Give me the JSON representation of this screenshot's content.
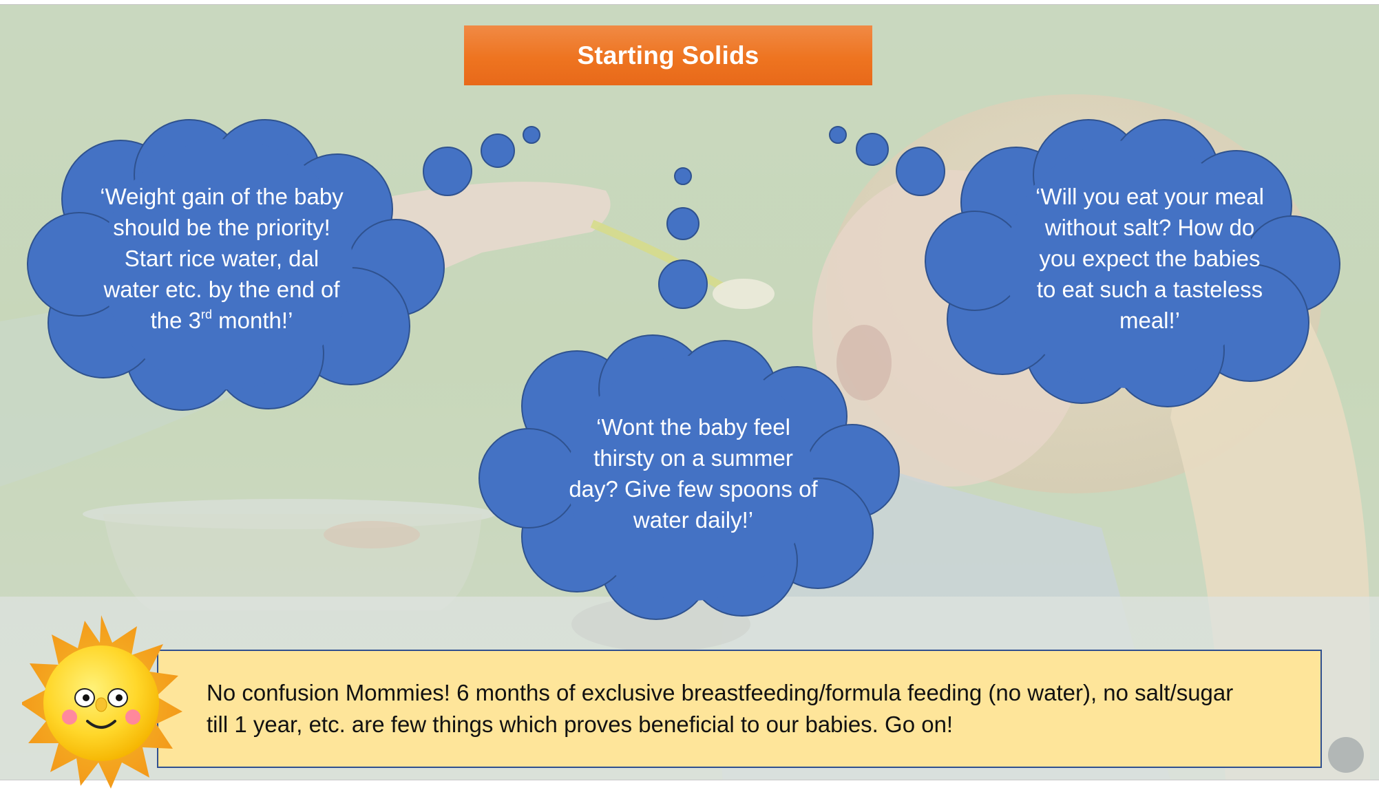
{
  "slide": {
    "title": "Starting Solids",
    "bubbles": {
      "left": {
        "lines": [
          "‘Weight gain of the baby",
          "should be the priority!",
          "Start rice water, dal",
          "water etc. by the end of"
        ],
        "last_line_prefix": "the 3",
        "last_line_sup": "rd",
        "last_line_suffix": " month!’"
      },
      "center": {
        "lines": [
          "‘Wont the baby feel",
          "thirsty on a summer",
          "day? Give few spoons of",
          "water daily!’"
        ]
      },
      "right": {
        "lines": [
          "‘Will you eat your meal",
          "without salt? How do",
          "you expect the babies",
          "to eat such a tasteless",
          "meal!’"
        ]
      }
    },
    "note": {
      "lines": [
        "No confusion Mommies! 6 months of exclusive breastfeeding/formula feeding (no water), no salt/sugar",
        "till 1 year, etc. are few things which proves beneficial to our babies. Go on!"
      ]
    },
    "icons": [
      "sun-icon",
      "thought-cloud-icon"
    ],
    "colors": {
      "title_bg": "#ee7420",
      "cloud_fill": "#4472c4",
      "cloud_stroke": "#2f528f",
      "note_bg": "#fee59a",
      "note_border": "#2f4f8f"
    }
  }
}
